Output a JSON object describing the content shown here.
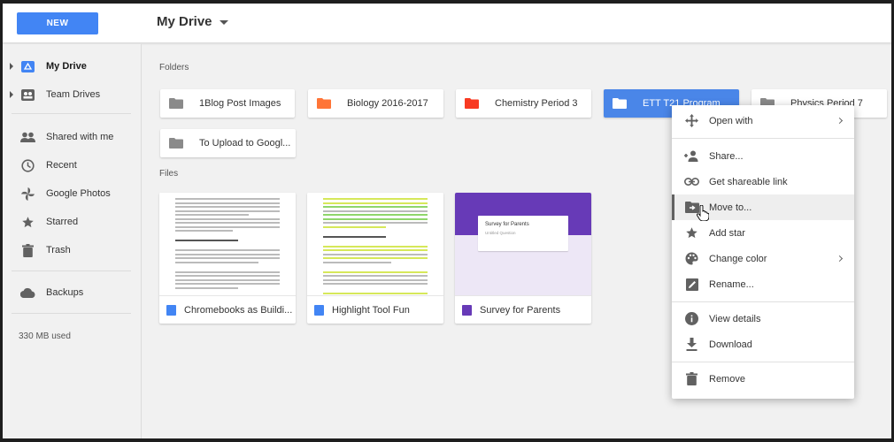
{
  "header": {
    "new_label": "NEW",
    "title": "My Drive"
  },
  "sidebar": {
    "items": [
      {
        "label": "My Drive",
        "icon": "drive-icon"
      },
      {
        "label": "Team Drives",
        "icon": "team-drives-icon"
      },
      {
        "label": "Shared with me",
        "icon": "people-icon"
      },
      {
        "label": "Recent",
        "icon": "clock-icon"
      },
      {
        "label": "Google Photos",
        "icon": "photos-pinwheel-icon"
      },
      {
        "label": "Starred",
        "icon": "star-icon"
      },
      {
        "label": "Trash",
        "icon": "trash-icon"
      },
      {
        "label": "Backups",
        "icon": "cloud-icon"
      }
    ],
    "storage": "330 MB used"
  },
  "main": {
    "folders_label": "Folders",
    "files_label": "Files",
    "folders": [
      {
        "name": "1Blog Post Images",
        "color": "#8a8a8a"
      },
      {
        "name": "Biology 2016-2017",
        "color": "#ff7537"
      },
      {
        "name": "Chemistry Period 3",
        "color": "#f83a22"
      },
      {
        "name": "ETT T21 Program",
        "color": "#ffffff"
      },
      {
        "name": "Physics Period 7",
        "color": "#8a8a8a"
      },
      {
        "name": "To Upload to Googl...",
        "color": "#8a8a8a"
      }
    ],
    "files": [
      {
        "name": "Chromebooks as Buildi...",
        "type": "doc",
        "color": "#4285f4"
      },
      {
        "name": "Highlight Tool Fun",
        "type": "doc",
        "color": "#4285f4"
      },
      {
        "name": "Survey for Parents",
        "type": "form",
        "color": "#673ab7",
        "thumb_title": "Survey for Parents",
        "thumb_subtitle": "Untitled Question"
      }
    ]
  },
  "menu": {
    "items": [
      {
        "label": "Open with",
        "icon": "move-arrows-icon",
        "submenu": true
      },
      {
        "label": "Share...",
        "icon": "person-add-icon"
      },
      {
        "label": "Get shareable link",
        "icon": "link-icon"
      },
      {
        "label": "Move to...",
        "icon": "folder-move-icon"
      },
      {
        "label": "Add star",
        "icon": "star-icon"
      },
      {
        "label": "Change color",
        "icon": "palette-icon",
        "submenu": true
      },
      {
        "label": "Rename...",
        "icon": "edit-icon"
      },
      {
        "label": "View details",
        "icon": "info-icon"
      },
      {
        "label": "Download",
        "icon": "download-icon"
      },
      {
        "label": "Remove",
        "icon": "trash-icon"
      }
    ]
  }
}
